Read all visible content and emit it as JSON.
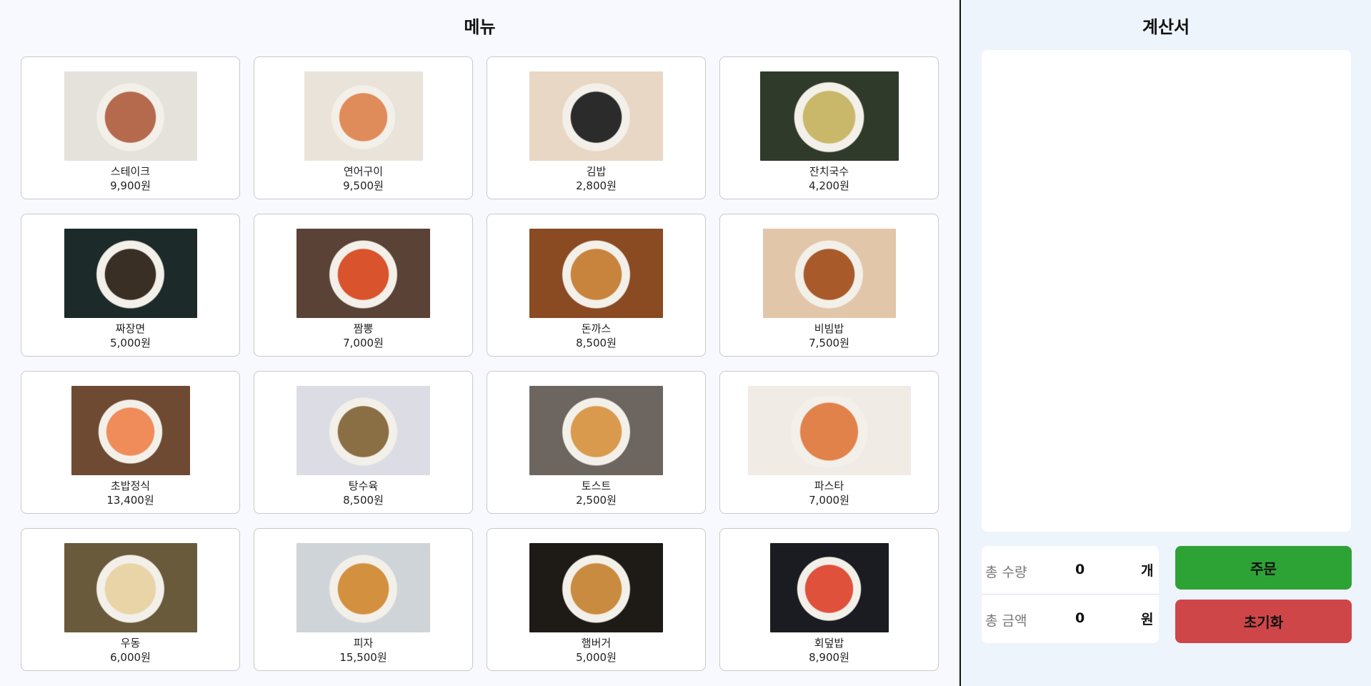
{
  "menu": {
    "title": "메뉴",
    "items": [
      {
        "name": "스테이크",
        "price": "9,900원",
        "icon": "steak-icon",
        "bg": "#e5e2dc",
        "accent": "#b56a4e"
      },
      {
        "name": "연어구이",
        "price": "9,500원",
        "icon": "salmon-icon",
        "bg": "#e9e3da",
        "accent": "#e08b5a"
      },
      {
        "name": "김밥",
        "price": "2,800원",
        "icon": "gimbap-icon",
        "bg": "#e8d7c4",
        "accent": "#2b2b2b"
      },
      {
        "name": "잔치국수",
        "price": "4,200원",
        "icon": "noodle-soup-icon",
        "bg": "#2f3a2a",
        "accent": "#c9b86a"
      },
      {
        "name": "짜장면",
        "price": "5,000원",
        "icon": "jjajangmyeon-icon",
        "bg": "#1c2a2a",
        "accent": "#3a2f25"
      },
      {
        "name": "짬뽕",
        "price": "7,000원",
        "icon": "jjamppong-icon",
        "bg": "#5a4236",
        "accent": "#d9532c"
      },
      {
        "name": "돈까스",
        "price": "8,500원",
        "icon": "tonkatsu-icon",
        "bg": "#8a4a22",
        "accent": "#c8843d"
      },
      {
        "name": "비빔밥",
        "price": "7,500원",
        "icon": "bibimbap-icon",
        "bg": "#e2c6aa",
        "accent": "#a85a2a"
      },
      {
        "name": "초밥정식",
        "price": "13,400원",
        "icon": "sushi-icon",
        "bg": "#6e4a33",
        "accent": "#f08c5a"
      },
      {
        "name": "탕수육",
        "price": "8,500원",
        "icon": "tangsuyuk-icon",
        "bg": "#dcdde4",
        "accent": "#8a6f45"
      },
      {
        "name": "토스트",
        "price": "2,500원",
        "icon": "toast-icon",
        "bg": "#6d6560",
        "accent": "#d99a4e"
      },
      {
        "name": "파스타",
        "price": "7,000원",
        "icon": "pasta-icon",
        "bg": "#f1ebe6",
        "accent": "#e0824a"
      },
      {
        "name": "우동",
        "price": "6,000원",
        "icon": "udon-icon",
        "bg": "#6a5a3c",
        "accent": "#e9d4a8"
      },
      {
        "name": "피자",
        "price": "15,500원",
        "icon": "pizza-icon",
        "bg": "#cfd4d8",
        "accent": "#d3903f"
      },
      {
        "name": "햄버거",
        "price": "5,000원",
        "icon": "hamburger-icon",
        "bg": "#1e1a15",
        "accent": "#c98b3f"
      },
      {
        "name": "회덮밥",
        "price": "8,900원",
        "icon": "hoedeopbap-icon",
        "bg": "#1a1c22",
        "accent": "#e0513c"
      }
    ]
  },
  "bill": {
    "title": "계산서",
    "total_qty_label": "총 수량",
    "total_qty_value": "0",
    "total_qty_unit": "개",
    "total_amount_label": "총 금액",
    "total_amount_value": "0",
    "total_amount_unit": "원",
    "order_label": "주문",
    "reset_label": "초기화"
  },
  "colors": {
    "order": "#2ea335",
    "reset": "#cf4649"
  }
}
